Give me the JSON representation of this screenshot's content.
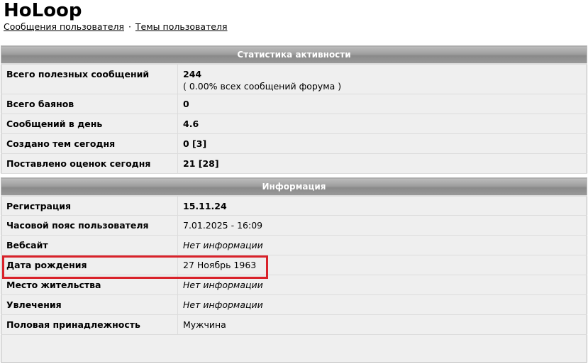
{
  "user": {
    "name": "HoLoop",
    "links": [
      {
        "label": "Сообщения пользователя"
      },
      {
        "label": "Темы пользователя"
      }
    ],
    "separator": "·"
  },
  "activity": {
    "title": "Статистика активности",
    "rows": [
      {
        "label": "Всего полезных сообщений",
        "value": "244",
        "sub": "( 0.00% всех сообщений форума )"
      },
      {
        "label": "Всего баянов",
        "value": "0"
      },
      {
        "label": "Сообщений в день",
        "value": "4.6"
      },
      {
        "label": "Создано тем сегодня",
        "value": "0 [3]"
      },
      {
        "label": "Поставлено оценок сегодня",
        "value": "21 [28]"
      }
    ]
  },
  "info": {
    "title": "Информация",
    "rows": [
      {
        "label": "Регистрация",
        "value": "15.11.24"
      },
      {
        "label": "Часовой пояс пользователя",
        "value": "7.01.2025 - 16:09"
      },
      {
        "label": "Вебсайт",
        "value": "Нет информации"
      },
      {
        "label": "Дата рождения",
        "value": "27 Ноябрь 1963"
      },
      {
        "label": "Место жительства",
        "value": "Нет информации"
      },
      {
        "label": "Увлечения",
        "value": "Нет информации"
      },
      {
        "label": "Половая принадлежность",
        "value": "Мужчина"
      }
    ]
  },
  "annotation": {
    "color": "#d9222a"
  }
}
